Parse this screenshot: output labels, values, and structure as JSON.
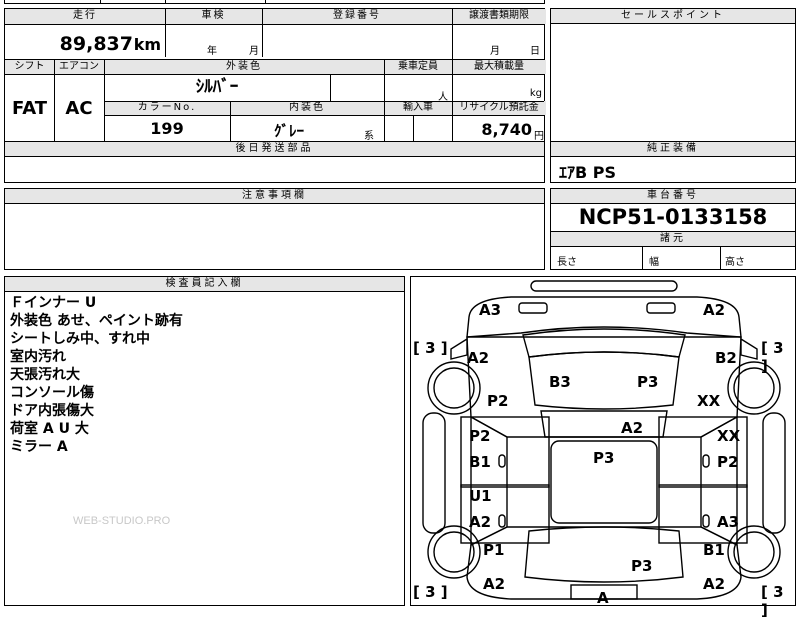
{
  "top_cut": {
    "c1": "",
    "c2": "",
    "c3": ""
  },
  "header": {
    "mileage_label": "走行",
    "shaken_label": "車検",
    "reg_label": "登録番号",
    "transfer_label": "譲渡書類期限",
    "sales_label": "セールスポイント"
  },
  "row1": {
    "mileage_value": "89,837",
    "mileage_unit": "km",
    "shaken_year": "年",
    "shaken_month": "月",
    "reg_value": "",
    "transfer_month": "月",
    "transfer_day": "日"
  },
  "row2": {
    "shift_label": "シフト",
    "ac_label": "エアコン",
    "ext_color_label": "外装色",
    "capacity_label": "乗車定員",
    "maxload_label": "最大積載量",
    "shift_value": "FAT",
    "ac_value": "AC",
    "ext_color_value": "ｼﾙﾊﾞｰ",
    "capacity_unit": "人",
    "maxload_unit": "kg",
    "colorno_label": "カラーNo.",
    "int_color_label": "内装色",
    "import_label": "輸入車",
    "recycle_label": "リサイクル預託金",
    "colorno_value": "199",
    "int_color_value": "ｸﾞﾚｰ",
    "int_color_suffix": "系",
    "recycle_value": "8,740",
    "recycle_unit": "円"
  },
  "later_parts": {
    "label": "後日発送部品",
    "value": ""
  },
  "genuine": {
    "label": "純正装備",
    "value": "ｴｱB PS"
  },
  "caution": {
    "label": "注意事項欄",
    "value": ""
  },
  "chassis": {
    "label": "車台番号",
    "value": "NCP51-0133158"
  },
  "dims": {
    "label": "諸元",
    "length": "長さ",
    "width": "幅",
    "height": "高さ"
  },
  "inspector": {
    "label": "検査員記入欄",
    "notes": [
      "Ｆインナー U",
      "外装色 あせ、ペイント跡有",
      "シートしみ中、すれ中",
      "室内汚れ",
      "天張汚れ大",
      "コンソール傷",
      "ドア内張傷大",
      "荷室 A U 大",
      "ミラー A"
    ],
    "watermark": "WEB-STUDIO.PRO"
  },
  "diagram": {
    "marks": {
      "m1": "A3",
      "m2": "A2",
      "m3": "A2",
      "m4": "B2",
      "m5": "B3",
      "m6": "P3",
      "m7": "P2",
      "m8": "XX",
      "m9": "A2",
      "m10": "P2",
      "m11": "XX",
      "m12": "B1",
      "m13": "P3",
      "m14": "P2",
      "m15": "U1",
      "m16": "A2",
      "m17": "A3",
      "m18": "P1",
      "m19": "B1",
      "m20": "P3",
      "m21": "A2",
      "m22": "A2",
      "m23": "A"
    },
    "brackets": {
      "b1": "[ 3 ]",
      "b2": "[ 3 ]",
      "b3": "[ 3 ]",
      "b4": "[ 3 ]"
    }
  }
}
